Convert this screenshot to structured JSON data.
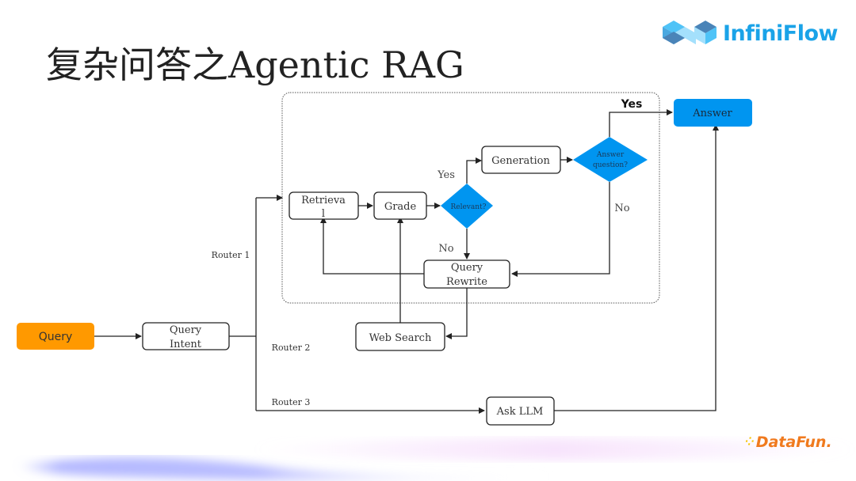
{
  "title": "复杂问答之Agentic RAG",
  "brand": {
    "name": "InfiniFlow",
    "color": "#1aa3e8",
    "footer_logo": "DataFun."
  },
  "colors": {
    "query_node": "#ff9900",
    "decision_node": "#0095f0",
    "answer_node": "#0095f0",
    "line": "#222222"
  },
  "nodes": {
    "query": "Query",
    "query_intent_line1": "Query",
    "query_intent_line2": "Intent",
    "retrieval_line1": "Retrieva",
    "retrieval_line2": "l",
    "grade": "Grade",
    "relevant": "Relevant?",
    "generation": "Generation",
    "answer_question_line1": "Answer",
    "answer_question_line2": "question?",
    "query_rewrite_line1": "Query",
    "query_rewrite_line2": "Rewrite",
    "web_search": "Web Search",
    "ask_llm": "Ask LLM",
    "answer": "Answer"
  },
  "edge_labels": {
    "relevant_yes": "Yes",
    "relevant_no": "No",
    "answer_yes": "Yes",
    "answer_no": "No",
    "router1": "Router 1",
    "router2": "Router 2",
    "router3": "Router 3"
  }
}
